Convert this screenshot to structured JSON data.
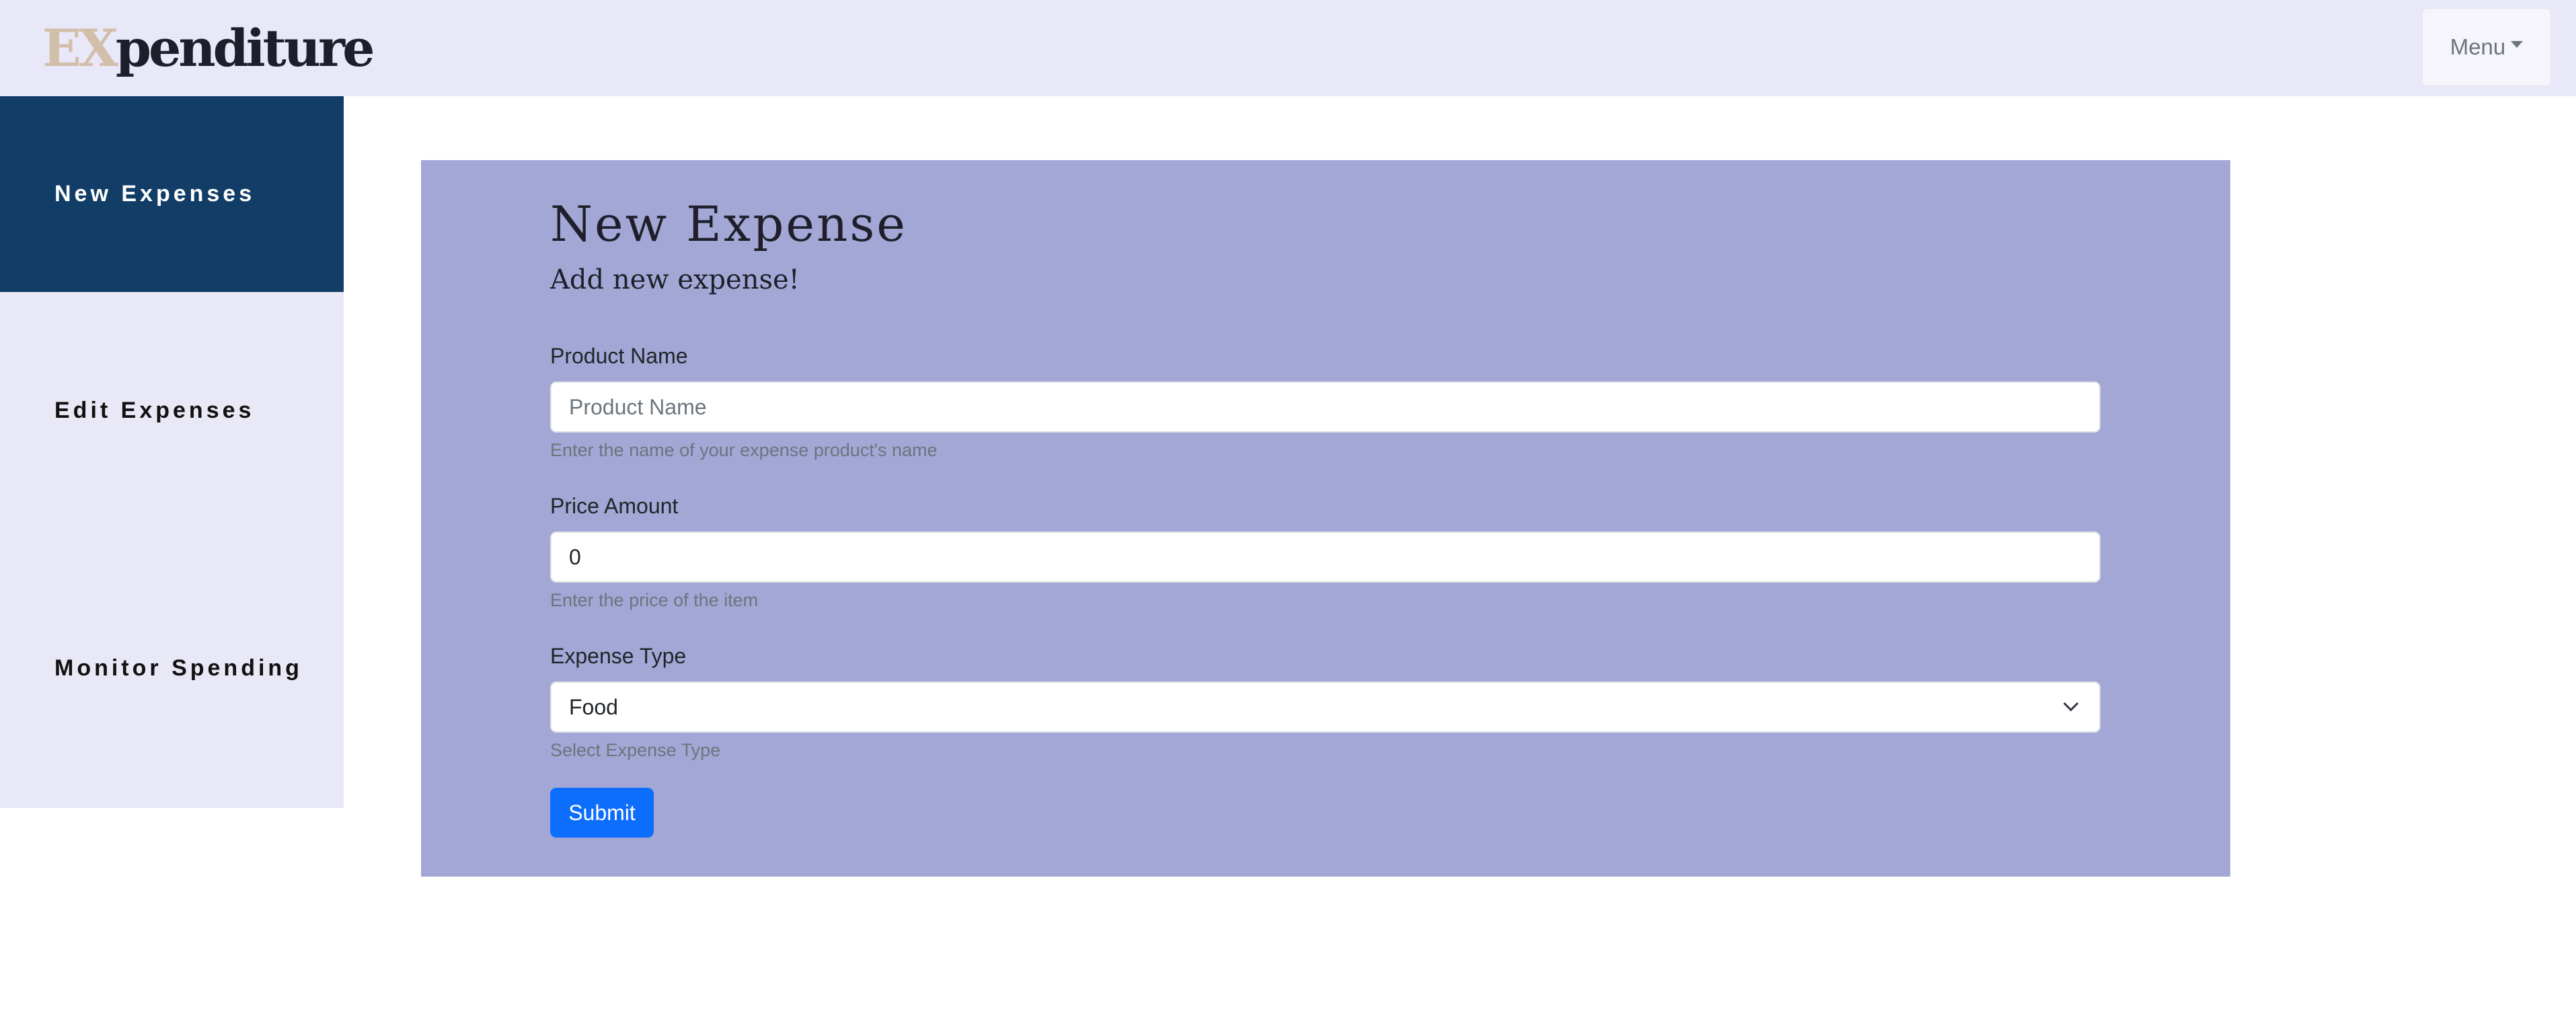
{
  "navbar": {
    "brand_prefix": "EX",
    "brand_suffix": "penditure",
    "menu_label": "Menu",
    "menu_icon": "caret-down-icon"
  },
  "sidebar": {
    "items": [
      {
        "label": "New Expenses",
        "active": true
      },
      {
        "label": "Edit Expenses",
        "active": false
      },
      {
        "label": "Monitor Spending",
        "active": false
      }
    ]
  },
  "form": {
    "title": "New Expense",
    "subtitle": "Add new expense!",
    "product_name": {
      "label": "Product Name",
      "placeholder": "Product Name",
      "value": "",
      "help": "Enter the name of your expense product's name"
    },
    "price_amount": {
      "label": "Price Amount",
      "value": "0",
      "help": "Enter the price of the item"
    },
    "expense_type": {
      "label": "Expense Type",
      "selected": "Food",
      "help": "Select Expense Type",
      "icon": "chevron-down-icon"
    },
    "submit_label": "Submit"
  },
  "colors": {
    "navbar_bg": "#e8e8f8",
    "sidebar_bg": "#e8e8f6",
    "sidebar_active_bg": "#123d66",
    "card_bg": "#a2a7d5",
    "brand_accent": "#d2bfaa",
    "primary_button": "#0d6efd"
  }
}
